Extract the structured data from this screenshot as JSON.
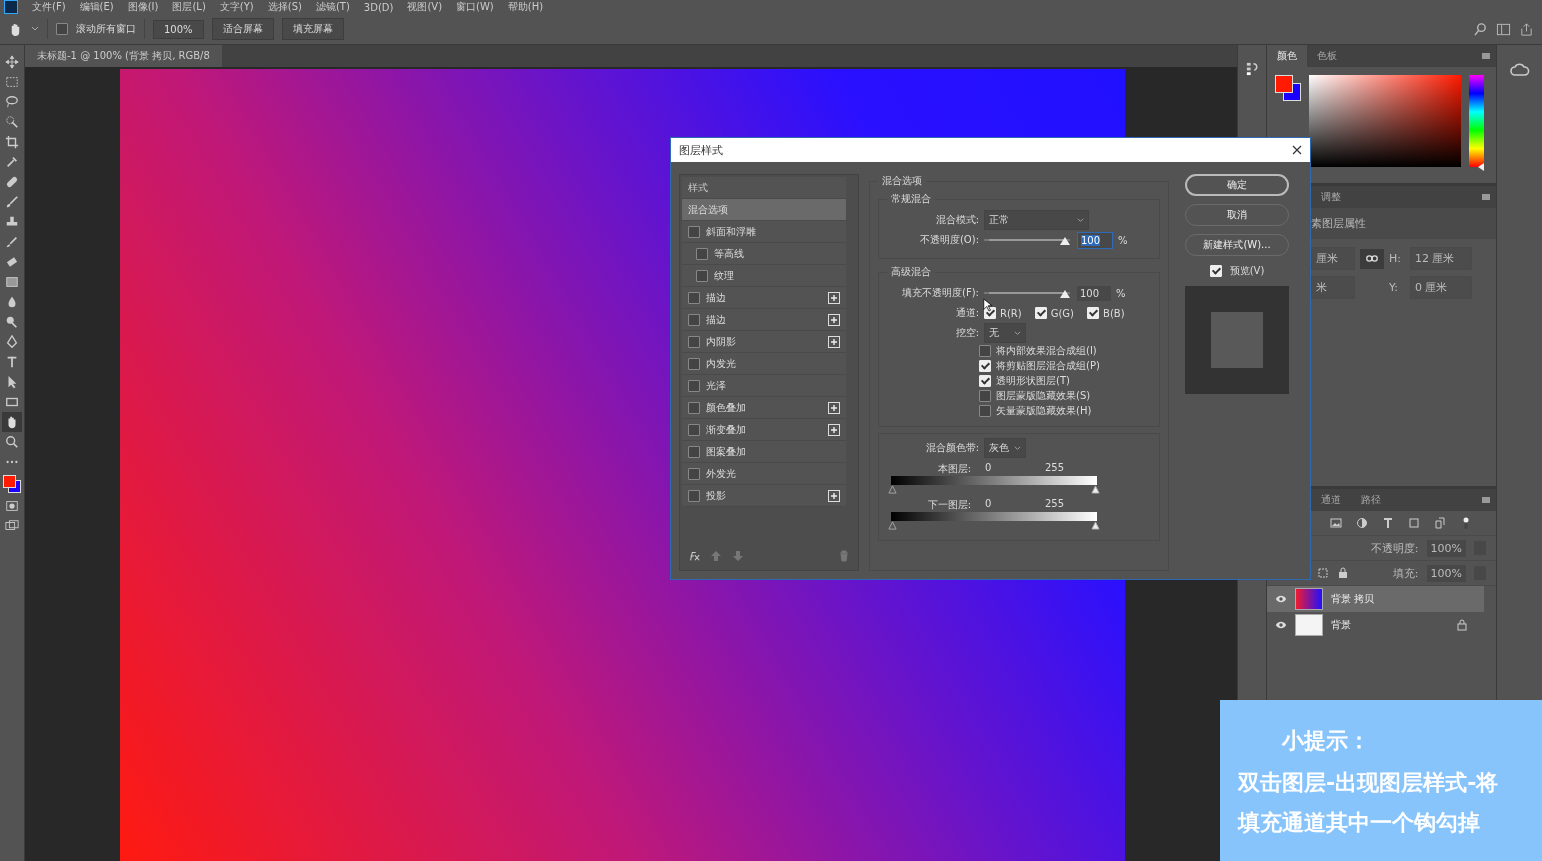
{
  "menu": [
    "文件(F)",
    "编辑(E)",
    "图像(I)",
    "图层(L)",
    "文字(Y)",
    "选择(S)",
    "滤镜(T)",
    "3D(D)",
    "视图(V)",
    "窗口(W)",
    "帮助(H)"
  ],
  "options_bar": {
    "scroll_all": {
      "label": "滚动所有窗口",
      "checked": false
    },
    "buttons": [
      "100%",
      "适合屏幕",
      "填充屏幕"
    ]
  },
  "document_tab": {
    "title": "未标题-1 @ 100% (背景 拷贝, RGB/8"
  },
  "color_panel": {
    "tabs": [
      {
        "label": "颜色",
        "selected": true
      },
      {
        "label": "色板",
        "selected": false
      }
    ],
    "hue": {
      "level": 0
    }
  },
  "properties_panel": {
    "tabs": [
      {
        "label": "调整"
      }
    ],
    "heading": "素图层属性",
    "fields": [
      {
        "value": "厘米"
      },
      {
        "label": "H:",
        "value": "12 厘米"
      },
      {
        "value": "米"
      },
      {
        "label": "Y:",
        "value": "0 厘米"
      }
    ]
  },
  "layers_panel": {
    "tabs": [
      {
        "label": "通道"
      },
      {
        "label": "路径"
      }
    ],
    "opacity": {
      "label": "不透明度:",
      "value": "100%"
    },
    "fill": {
      "label": "填充:",
      "value": "100%"
    },
    "layers": [
      {
        "name": "背景 拷贝",
        "selected": true,
        "visible": true,
        "locked": false,
        "kind": "gradient"
      },
      {
        "name": "背景",
        "selected": false,
        "visible": true,
        "locked": true,
        "kind": "white"
      }
    ]
  },
  "dialog": {
    "title": "图层样式",
    "styles": {
      "heading": "样式",
      "items": [
        {
          "label": "混合选项",
          "kind": "plain",
          "selected": true,
          "add": false
        },
        {
          "label": "斜面和浮雕",
          "kind": "check",
          "selected": false,
          "checked": false,
          "add": false,
          "children": [
            {
              "label": "等高线",
              "kind": "check",
              "selected": false,
              "checked": false
            },
            {
              "label": "纹理",
              "kind": "check",
              "selected": false,
              "checked": false
            }
          ]
        },
        {
          "label": "描边",
          "kind": "check",
          "selected": false,
          "checked": false,
          "add": true
        },
        {
          "label": "描边",
          "kind": "check",
          "selected": false,
          "checked": false,
          "add": true
        },
        {
          "label": "内阴影",
          "kind": "check",
          "selected": false,
          "checked": false,
          "add": true
        },
        {
          "label": "内发光",
          "kind": "check",
          "selected": false,
          "checked": false,
          "add": false
        },
        {
          "label": "光泽",
          "kind": "check",
          "selected": false,
          "checked": false,
          "add": false
        },
        {
          "label": "颜色叠加",
          "kind": "check",
          "selected": false,
          "checked": false,
          "add": true
        },
        {
          "label": "渐变叠加",
          "kind": "check",
          "selected": false,
          "checked": false,
          "add": true
        },
        {
          "label": "图案叠加",
          "kind": "check",
          "selected": false,
          "checked": false,
          "add": false
        },
        {
          "label": "外发光",
          "kind": "check",
          "selected": false,
          "checked": false,
          "add": false
        },
        {
          "label": "投影",
          "kind": "check",
          "selected": false,
          "checked": false,
          "add": true
        }
      ]
    },
    "blending": {
      "title": "混合选项",
      "general": {
        "title": "常规混合",
        "mode": {
          "label": "混合模式:",
          "value": "正常"
        },
        "opacity": {
          "label": "不透明度(O):",
          "level": 1,
          "value": "100",
          "unit": "%"
        }
      },
      "advanced": {
        "title": "高级混合",
        "fill_opacity": {
          "label": "填充不透明度(F):",
          "level": 1,
          "value": "100",
          "unit": "%"
        },
        "channels": {
          "label": "通道:",
          "items": [
            {
              "label": "R(R)",
              "checked": true
            },
            {
              "label": "G(G)",
              "checked": true
            },
            {
              "label": "B(B)",
              "checked": true
            }
          ]
        },
        "knockout": {
          "label": "挖空:",
          "value": "无"
        },
        "options": [
          {
            "label": "将内部效果混合成组(I)",
            "checked": false
          },
          {
            "label": "将剪贴图层混合成组(P)",
            "checked": true
          },
          {
            "label": "透明形状图层(T)",
            "checked": true
          },
          {
            "label": "图层蒙版隐藏效果(S)",
            "checked": false
          },
          {
            "label": "矢量蒙版隐藏效果(H)",
            "checked": false
          }
        ]
      },
      "blend_if": {
        "label": "混合颜色带:",
        "value": "灰色",
        "ranges": [
          {
            "label": "本图层:",
            "low": "0",
            "high": "255"
          },
          {
            "label": "下一图层:",
            "low": "0",
            "high": "255"
          }
        ]
      }
    },
    "buttons": [
      {
        "label": "确定",
        "kind": "default"
      },
      {
        "label": "取消",
        "kind": "normal"
      },
      {
        "label": "新建样式(W)...",
        "kind": "normal"
      }
    ],
    "preview": {
      "label": "预览(V)",
      "checked": true
    }
  },
  "tip": {
    "title": "小提示：",
    "lines": [
      "双击图层-出现图层样式-将",
      "填充通道其中一个钩勾掉"
    ]
  }
}
